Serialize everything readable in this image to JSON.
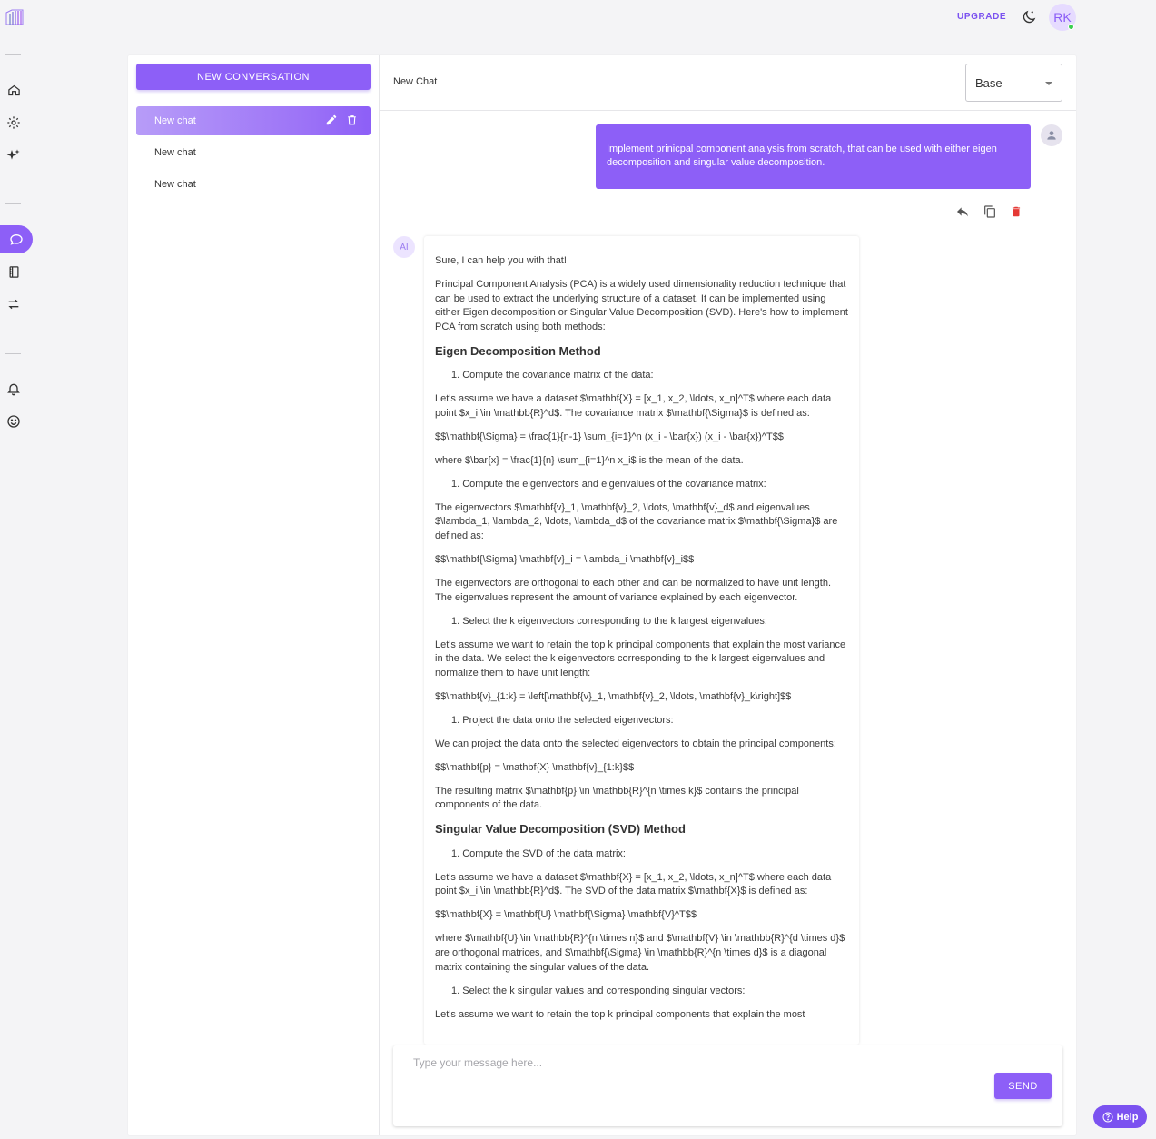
{
  "topbar": {
    "upgrade_label": "UPGRADE",
    "avatar_initials": "RK"
  },
  "sidebar_nav": [
    "home-icon",
    "settings-icon",
    "sparkles-icon",
    "chat-icon",
    "notebook-icon",
    "swap-icon",
    "bell-icon",
    "emoji-icon"
  ],
  "conversations": {
    "new_button_label": "NEW CONVERSATION",
    "items": [
      {
        "label": "New chat",
        "active": true
      },
      {
        "label": "New chat",
        "active": false
      },
      {
        "label": "New chat",
        "active": false
      }
    ]
  },
  "chat": {
    "title": "New Chat",
    "model_selected": "Base",
    "user_message": "Implement prinicpal component analysis from scratch, that can be used with either eigen decomposition and singular value decomposition.",
    "ai_avatar_label": "AI",
    "ai_message": {
      "p1": "Sure, I can help you with that!",
      "p2": "Principal Component Analysis (PCA) is a widely used dimensionality reduction technique that can be used to extract the underlying structure of a dataset. It can be implemented using either Eigen decomposition or Singular Value Decomposition (SVD). Here's how to implement PCA from scratch using both methods:",
      "h1": "Eigen Decomposition Method",
      "s1": "1. Compute the covariance matrix of the data:",
      "p3": "Let's assume we have a dataset $\\mathbf{X} = [x_1, x_2, \\ldots, x_n]^T$ where each data point $x_i \\in \\mathbb{R}^d$. The covariance matrix $\\mathbf{\\Sigma}$ is defined as:",
      "p4": "$$\\mathbf{\\Sigma} = \\frac{1}{n-1} \\sum_{i=1}^n (x_i - \\bar{x}) (x_i - \\bar{x})^T$$",
      "p5": "where $\\bar{x} = \\frac{1}{n} \\sum_{i=1}^n x_i$ is the mean of the data.",
      "s2": "1. Compute the eigenvectors and eigenvalues of the covariance matrix:",
      "p6": "The eigenvectors $\\mathbf{v}_1, \\mathbf{v}_2, \\ldots, \\mathbf{v}_d$ and eigenvalues $\\lambda_1, \\lambda_2, \\ldots, \\lambda_d$ of the covariance matrix $\\mathbf{\\Sigma}$ are defined as:",
      "p7": "$$\\mathbf{\\Sigma} \\mathbf{v}_i = \\lambda_i \\mathbf{v}_i$$",
      "p8": "The eigenvectors are orthogonal to each other and can be normalized to have unit length. The eigenvalues represent the amount of variance explained by each eigenvector.",
      "s3": "1. Select the k eigenvectors corresponding to the k largest eigenvalues:",
      "p9": "Let's assume we want to retain the top k principal components that explain the most variance in the data. We select the k eigenvectors corresponding to the k largest eigenvalues and normalize them to have unit length:",
      "p10": "$$\\mathbf{v}_{1:k} = \\left[\\mathbf{v}_1, \\mathbf{v}_2, \\ldots, \\mathbf{v}_k\\right]$$",
      "s4": "1. Project the data onto the selected eigenvectors:",
      "p11": "We can project the data onto the selected eigenvectors to obtain the principal components:",
      "p12": "$$\\mathbf{p} = \\mathbf{X} \\mathbf{v}_{1:k}$$",
      "p13": "The resulting matrix $\\mathbf{p} \\in \\mathbb{R}^{n \\times k}$ contains the principal components of the data.",
      "h2": "Singular Value Decomposition (SVD) Method",
      "s5": "1. Compute the SVD of the data matrix:",
      "p14": "Let's assume we have a dataset $\\mathbf{X} = [x_1, x_2, \\ldots, x_n]^T$ where each data point $x_i \\in \\mathbb{R}^d$. The SVD of the data matrix $\\mathbf{X}$ is defined as:",
      "p15": "$$\\mathbf{X} = \\mathbf{U} \\mathbf{\\Sigma} \\mathbf{V}^T$$",
      "p16": "where $\\mathbf{U} \\in \\mathbb{R}^{n \\times n}$ and $\\mathbf{V} \\in \\mathbb{R}^{d \\times d}$ are orthogonal matrices, and $\\mathbf{\\Sigma} \\in \\mathbb{R}^{n \\times d}$ is a diagonal matrix containing the singular values of the data.",
      "s6": "1. Select the k singular values and corresponding singular vectors:",
      "p17": "Let's assume we want to retain the top k principal components that explain the most"
    }
  },
  "composer": {
    "placeholder": "Type your message here...",
    "send_label": "SEND"
  },
  "help": {
    "label": "Help"
  },
  "colors": {
    "accent": "#8d5ff7",
    "delete": "#e53935",
    "online": "#3ad04e"
  }
}
